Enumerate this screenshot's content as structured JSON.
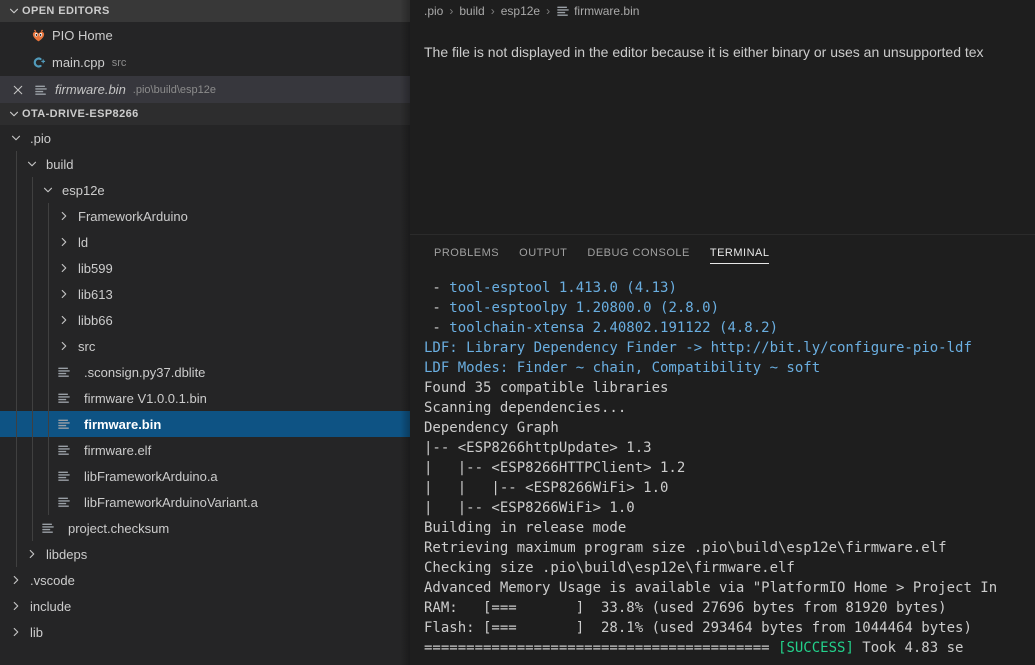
{
  "sidebar": {
    "open_editors": {
      "title": "OPEN EDITORS",
      "twisty": "chevron-down-icon",
      "items": [
        {
          "label": "PIO Home",
          "description": "",
          "icon": "platformio-icon",
          "active": false,
          "closable": false
        },
        {
          "label": "main.cpp",
          "description": "src",
          "icon": "cpp-icon",
          "active": false,
          "closable": false
        },
        {
          "label": "firmware.bin",
          "description": ".pio\\build\\esp12e",
          "icon": "binary-file-icon",
          "active": true,
          "closable": true
        }
      ]
    },
    "explorer": {
      "title": "OTA-DRIVE-ESP8266",
      "twisty": "chevron-down-icon",
      "items": [
        {
          "label": ".pio",
          "depth": 1,
          "type": "folder",
          "expanded": true,
          "selected": false
        },
        {
          "label": "build",
          "depth": 2,
          "type": "folder",
          "expanded": true,
          "selected": false
        },
        {
          "label": "esp12e",
          "depth": 3,
          "type": "folder",
          "expanded": true,
          "selected": false
        },
        {
          "label": "FrameworkArduino",
          "depth": 4,
          "type": "folder",
          "expanded": false,
          "selected": false
        },
        {
          "label": "ld",
          "depth": 4,
          "type": "folder",
          "expanded": false,
          "selected": false
        },
        {
          "label": "lib599",
          "depth": 4,
          "type": "folder",
          "expanded": false,
          "selected": false
        },
        {
          "label": "lib613",
          "depth": 4,
          "type": "folder",
          "expanded": false,
          "selected": false
        },
        {
          "label": "libb66",
          "depth": 4,
          "type": "folder",
          "expanded": false,
          "selected": false
        },
        {
          "label": "src",
          "depth": 4,
          "type": "folder",
          "expanded": false,
          "selected": false
        },
        {
          "label": ".sconsign.py37.dblite",
          "depth": 4,
          "type": "file",
          "expanded": false,
          "selected": false
        },
        {
          "label": "firmware V1.0.0.1.bin",
          "depth": 4,
          "type": "file",
          "expanded": false,
          "selected": false
        },
        {
          "label": "firmware.bin",
          "depth": 4,
          "type": "file",
          "expanded": false,
          "selected": true
        },
        {
          "label": "firmware.elf",
          "depth": 4,
          "type": "file",
          "expanded": false,
          "selected": false
        },
        {
          "label": "libFrameworkArduino.a",
          "depth": 4,
          "type": "file",
          "expanded": false,
          "selected": false
        },
        {
          "label": "libFrameworkArduinoVariant.a",
          "depth": 4,
          "type": "file",
          "expanded": false,
          "selected": false
        },
        {
          "label": "project.checksum",
          "depth": 3,
          "type": "file",
          "expanded": false,
          "selected": false
        },
        {
          "label": "libdeps",
          "depth": 2,
          "type": "folder",
          "expanded": false,
          "selected": false
        },
        {
          "label": ".vscode",
          "depth": 1,
          "type": "folder",
          "expanded": false,
          "selected": false
        },
        {
          "label": "include",
          "depth": 1,
          "type": "folder",
          "expanded": false,
          "selected": false
        },
        {
          "label": "lib",
          "depth": 1,
          "type": "folder",
          "expanded": false,
          "selected": false
        }
      ]
    }
  },
  "editor": {
    "breadcrumb": [
      {
        "label": ".pio",
        "icon": ""
      },
      {
        "label": "build",
        "icon": ""
      },
      {
        "label": "esp12e",
        "icon": ""
      },
      {
        "label": "firmware.bin",
        "icon": "binary-file-icon"
      }
    ],
    "message": "The file is not displayed in the editor because it is either binary or uses an unsupported tex"
  },
  "panel": {
    "tabs": [
      {
        "label": "PROBLEMS",
        "active": false
      },
      {
        "label": "OUTPUT",
        "active": false
      },
      {
        "label": "DEBUG CONSOLE",
        "active": false
      },
      {
        "label": "TERMINAL",
        "active": true
      }
    ],
    "terminal_lines": [
      [
        {
          "t": " - ",
          "c": "default"
        },
        {
          "t": "tool-esptool 1.413.0 (4.13)",
          "c": "blue"
        }
      ],
      [
        {
          "t": " - ",
          "c": "default"
        },
        {
          "t": "tool-esptoolpy 1.20800.0 (2.8.0)",
          "c": "blue"
        }
      ],
      [
        {
          "t": " - ",
          "c": "default"
        },
        {
          "t": "toolchain-xtensa 2.40802.191122 (4.8.2)",
          "c": "blue"
        }
      ],
      [
        {
          "t": "LDF: Library Dependency Finder -> http://bit.ly/configure-pio-ldf",
          "c": "blue"
        }
      ],
      [
        {
          "t": "LDF Modes: Finder ~ chain, Compatibility ~ soft",
          "c": "blue"
        }
      ],
      [
        {
          "t": "Found 35 compatible libraries",
          "c": "default"
        }
      ],
      [
        {
          "t": "Scanning dependencies...",
          "c": "default"
        }
      ],
      [
        {
          "t": "Dependency Graph",
          "c": "default"
        }
      ],
      [
        {
          "t": "|-- <ESP8266httpUpdate> 1.3",
          "c": "default"
        }
      ],
      [
        {
          "t": "|   |-- <ESP8266HTTPClient> 1.2",
          "c": "default"
        }
      ],
      [
        {
          "t": "|   |   |-- <ESP8266WiFi> 1.0",
          "c": "default"
        }
      ],
      [
        {
          "t": "|   |-- <ESP8266WiFi> 1.0",
          "c": "default"
        }
      ],
      [
        {
          "t": "Building in release mode",
          "c": "default"
        }
      ],
      [
        {
          "t": "Retrieving maximum program size .pio\\build\\esp12e\\firmware.elf",
          "c": "default"
        }
      ],
      [
        {
          "t": "Checking size .pio\\build\\esp12e\\firmware.elf",
          "c": "default"
        }
      ],
      [
        {
          "t": "Advanced Memory Usage is available via \"PlatformIO Home > Project In",
          "c": "default"
        }
      ],
      [
        {
          "t": "RAM:   [===       ]  33.8% (used 27696 bytes from 81920 bytes)",
          "c": "default"
        }
      ],
      [
        {
          "t": "Flash: [===       ]  28.1% (used 293464 bytes from 1044464 bytes)",
          "c": "default"
        }
      ],
      [
        {
          "t": "========================================= ",
          "c": "default"
        },
        {
          "t": "[SUCCESS]",
          "c": "green"
        },
        {
          "t": " Took 4.83 se",
          "c": "default"
        }
      ]
    ]
  },
  "colors": {
    "selection_blue": "#0e5384",
    "sidebar_bg": "#252526",
    "editor_bg": "#1e1e1e",
    "terminal_blue": "#6aaee0",
    "terminal_green": "#23d18b",
    "pio_orange": "#e8743b",
    "cpp_blue": "#519aba"
  }
}
